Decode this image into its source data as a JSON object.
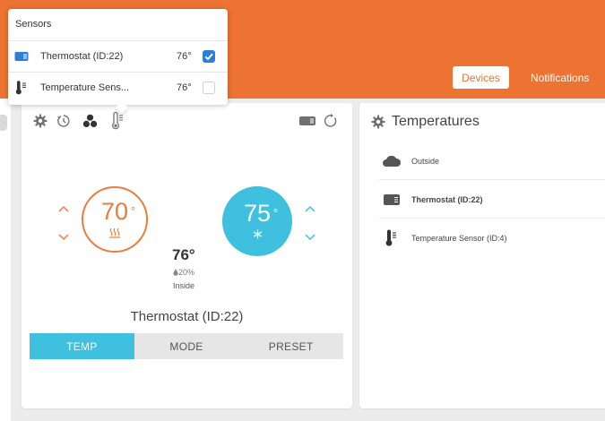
{
  "header": {
    "nav": {
      "devices": "Devices",
      "notifications": "Notifications"
    },
    "accent": "#ec7331"
  },
  "thermostat": {
    "heat_setpoint": "70",
    "cool_setpoint": "75",
    "degree": "°",
    "inside_temp": "76°",
    "humidity": "20%",
    "inside_label": "Inside",
    "name": "Thermostat (ID:22)",
    "tabs": [
      "TEMP",
      "MODE",
      "PRESET"
    ],
    "active_tab": "TEMP",
    "heat_color": "#ec7c3c",
    "cool_color": "#3ec0de"
  },
  "temperatures": {
    "title": "Temperatures",
    "rows": [
      {
        "label": "Outside",
        "icon": "cloud-icon",
        "bold": false
      },
      {
        "label": "Thermostat (ID:22)",
        "icon": "thermostat-device-icon",
        "bold": true
      },
      {
        "label": "Temperature Sensor (ID:4)",
        "icon": "thermometer-icon",
        "bold": false
      }
    ]
  },
  "sensors_popup": {
    "title": "Sensors",
    "items": [
      {
        "name": "Thermostat (ID:22)",
        "temp": "76°",
        "checked": true,
        "icon": "thermostat-device-icon"
      },
      {
        "name": "Temperature Sens...",
        "temp": "76°",
        "checked": false,
        "icon": "thermometer-icon"
      }
    ]
  }
}
